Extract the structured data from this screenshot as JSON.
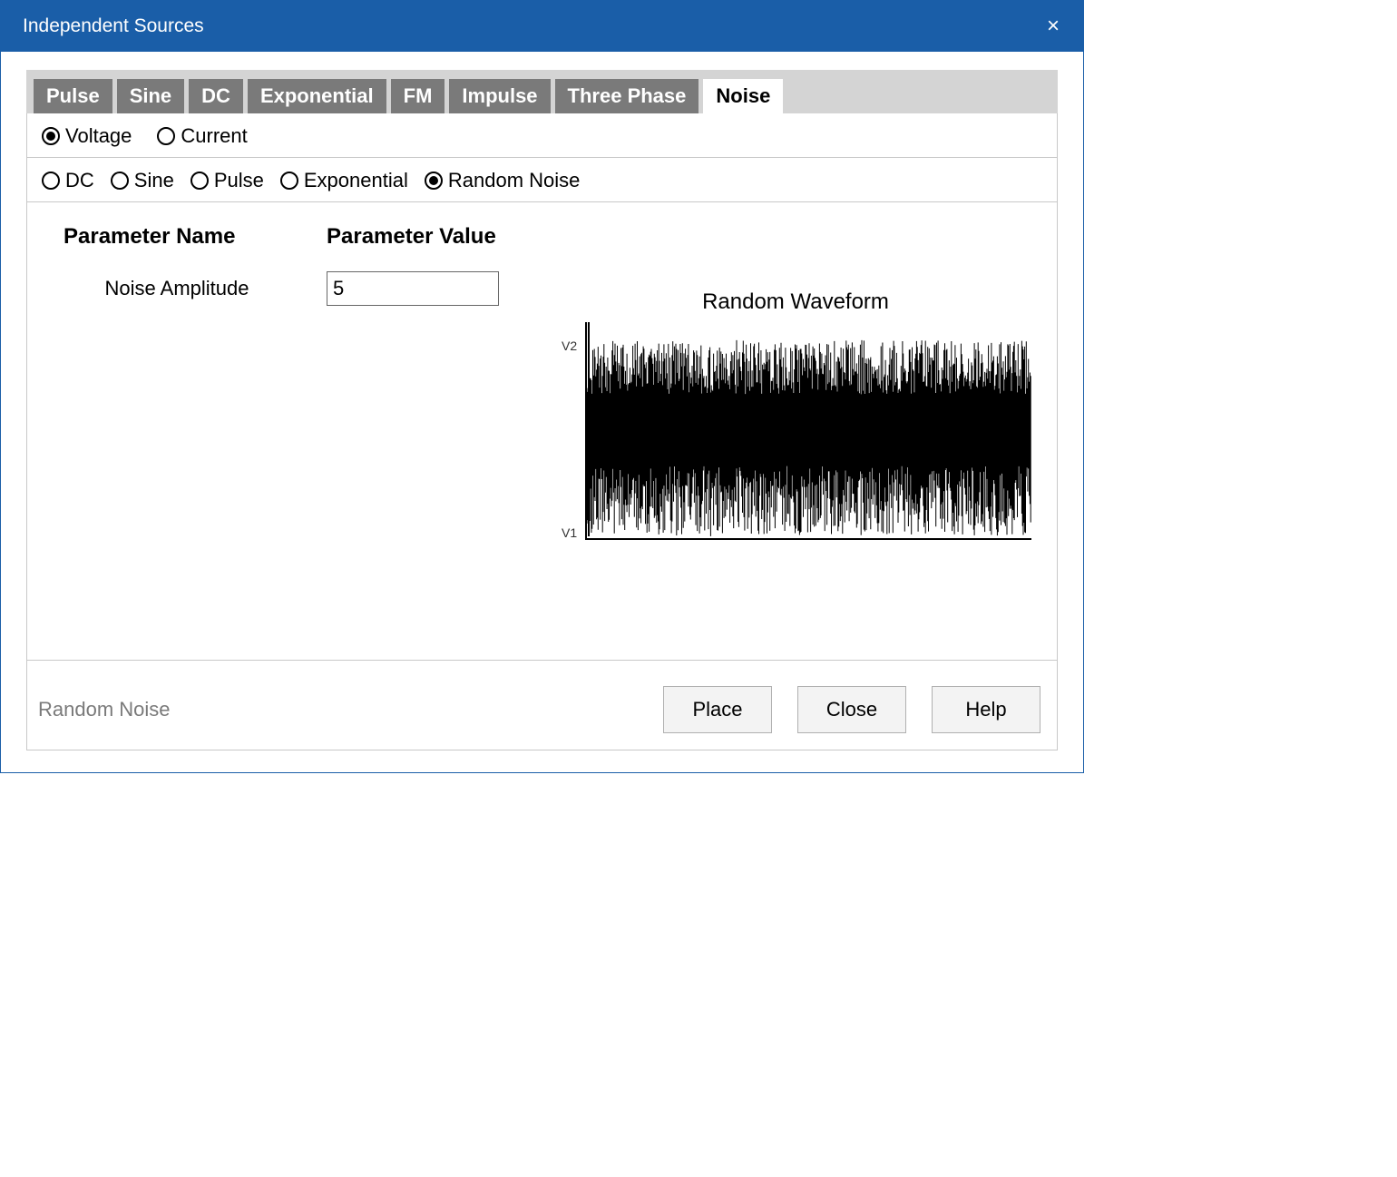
{
  "window": {
    "title": "Independent Sources",
    "close_icon": "×"
  },
  "tabs": [
    {
      "label": "Pulse",
      "active": false
    },
    {
      "label": "Sine",
      "active": false
    },
    {
      "label": "DC",
      "active": false
    },
    {
      "label": "Exponential",
      "active": false
    },
    {
      "label": "FM",
      "active": false
    },
    {
      "label": "Impulse",
      "active": false
    },
    {
      "label": "Three Phase",
      "active": false
    },
    {
      "label": "Noise",
      "active": true
    }
  ],
  "source_type": {
    "options": [
      {
        "label": "Voltage",
        "checked": true
      },
      {
        "label": "Current",
        "checked": false
      }
    ]
  },
  "waveform_type": {
    "options": [
      {
        "label": "DC",
        "checked": false
      },
      {
        "label": "Sine",
        "checked": false
      },
      {
        "label": "Pulse",
        "checked": false
      },
      {
        "label": "Exponential",
        "checked": false
      },
      {
        "label": "Random Noise",
        "checked": true
      }
    ]
  },
  "param_headers": {
    "name": "Parameter Name",
    "value": "Parameter Value"
  },
  "parameters": [
    {
      "label": "Noise Amplitude",
      "value": "5"
    }
  ],
  "chart": {
    "title": "Random Waveform",
    "y_top": "V2",
    "y_bot": "V1"
  },
  "chart_data": {
    "type": "line",
    "title": "Random Waveform",
    "xlabel": "",
    "ylabel": "",
    "ylim": [
      "V1",
      "V2"
    ],
    "description": "Dense random noise trace filling the region between V1 and V2 across the full horizontal extent.",
    "series": [
      {
        "name": "noise",
        "note": "random amplitude between V1 and V2, ~400 samples"
      }
    ]
  },
  "footer": {
    "label": "Random Noise",
    "buttons": {
      "place": "Place",
      "close": "Close",
      "help": "Help"
    }
  }
}
